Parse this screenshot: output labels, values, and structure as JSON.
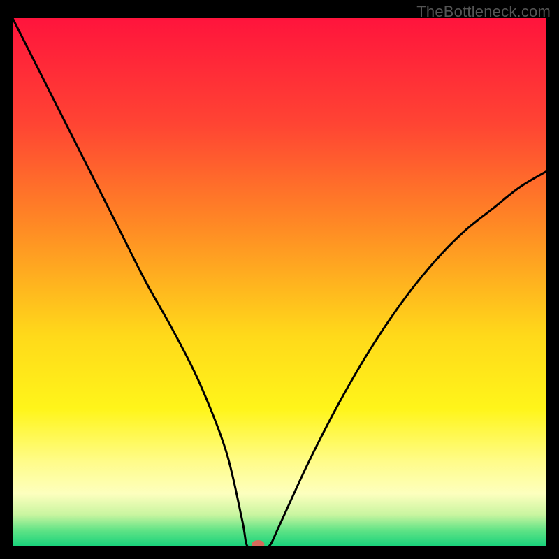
{
  "watermark": "TheBottleneck.com",
  "chart_data": {
    "type": "line",
    "title": "",
    "xlabel": "",
    "ylabel": "",
    "xlim": [
      0,
      100
    ],
    "ylim": [
      0,
      100
    ],
    "grid": false,
    "series": [
      {
        "name": "curve",
        "x": [
          0,
          5,
          10,
          15,
          20,
          25,
          30,
          35,
          40,
          43,
          44,
          46,
          48,
          50,
          55,
          60,
          65,
          70,
          75,
          80,
          85,
          90,
          95,
          100
        ],
        "y": [
          100,
          90,
          80,
          70,
          60,
          50,
          41,
          31,
          18,
          5,
          0,
          0,
          0,
          4,
          15,
          25,
          34,
          42,
          49,
          55,
          60,
          64,
          68,
          71
        ]
      }
    ],
    "background": {
      "type": "vertical-gradient",
      "stops": [
        {
          "offset": 0.0,
          "color": "#ff143c"
        },
        {
          "offset": 0.2,
          "color": "#ff4433"
        },
        {
          "offset": 0.4,
          "color": "#ff8c24"
        },
        {
          "offset": 0.6,
          "color": "#ffd91a"
        },
        {
          "offset": 0.74,
          "color": "#fff51a"
        },
        {
          "offset": 0.84,
          "color": "#fffc8a"
        },
        {
          "offset": 0.9,
          "color": "#fdffbe"
        },
        {
          "offset": 0.94,
          "color": "#c9f5a0"
        },
        {
          "offset": 0.97,
          "color": "#5fe386"
        },
        {
          "offset": 1.0,
          "color": "#17d27b"
        }
      ]
    },
    "marker": {
      "x": 46,
      "y": 0,
      "color": "#d66a5c"
    }
  }
}
